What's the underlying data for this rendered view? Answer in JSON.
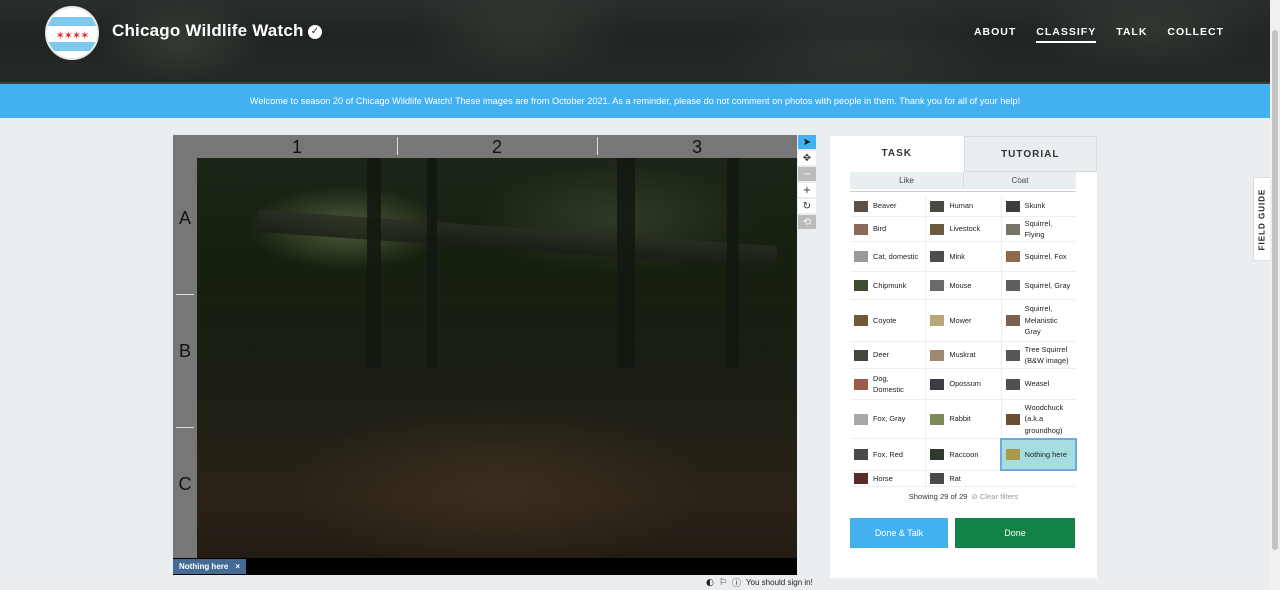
{
  "header": {
    "title": "Chicago Wildlife Watch",
    "verified_mark": "✓",
    "nav": [
      {
        "label": "ABOUT",
        "active": false
      },
      {
        "label": "CLASSIFY",
        "active": true
      },
      {
        "label": "TALK",
        "active": false
      },
      {
        "label": "COLLECT",
        "active": false
      }
    ]
  },
  "banner": {
    "text": "Welcome to season 20 of Chicago Wildlife Watch! These images are from October 2021. As a reminder, please do not comment on photos with people in them. Thank you for all of your help!"
  },
  "viewer": {
    "columns": [
      "1",
      "2",
      "3"
    ],
    "rows": [
      "A",
      "B",
      "C"
    ],
    "selected_tag": "Nothing here",
    "tag_close": "×",
    "sign_in_note": "You should sign in!"
  },
  "task_panel": {
    "tabs": [
      "TASK",
      "TUTORIAL"
    ],
    "filters": [
      "Like",
      "Coat"
    ],
    "choices": [
      [
        {
          "label": "Beaver",
          "color": "#5b5046"
        },
        {
          "label": "Human",
          "color": "#4a4a44"
        },
        {
          "label": "Skunk",
          "color": "#3d3d3d"
        }
      ],
      [
        {
          "label": "Bird",
          "color": "#8a6a5a"
        },
        {
          "label": "Livestock",
          "color": "#6b5a3e"
        },
        {
          "label": "Squirrel, Flying",
          "color": "#77746c"
        }
      ],
      [
        {
          "label": "Cat, domestic",
          "color": "#9a9a9a"
        },
        {
          "label": "Mink",
          "color": "#4d4d4d"
        },
        {
          "label": "Squirrel, Fox",
          "color": "#8b6a4f"
        }
      ],
      [
        {
          "label": "Chipmunk",
          "color": "#3f4a32"
        },
        {
          "label": "Mouse",
          "color": "#6a6a6a"
        },
        {
          "label": "Squirrel, Gray",
          "color": "#5e5e5e"
        }
      ],
      [
        {
          "label": "Coyote",
          "color": "#6e5a3a"
        },
        {
          "label": "Mower",
          "color": "#b8a878"
        },
        {
          "label": "Squirrel, Melanistic Gray",
          "color": "#7a6050"
        }
      ],
      [
        {
          "label": "Deer",
          "color": "#45453f"
        },
        {
          "label": "Muskrat",
          "color": "#a08870"
        },
        {
          "label": "Tree Squirrel (B&W image)",
          "color": "#555"
        }
      ],
      [
        {
          "label": "Dog, Domestic",
          "color": "#9b5c4e"
        },
        {
          "label": "Opossum",
          "color": "#3c3c44"
        },
        {
          "label": "Weasel",
          "color": "#4f4f4f"
        }
      ],
      [
        {
          "label": "Fox, Gray",
          "color": "#a8a8a8"
        },
        {
          "label": "Rabbit",
          "color": "#7d8a5a"
        },
        {
          "label": "Woodchuck (a.k.a groundhog)",
          "color": "#6b4e32"
        }
      ],
      [
        {
          "label": "Fox, Red",
          "color": "#4a4a4a"
        },
        {
          "label": "Raccoon",
          "color": "#2f3a2a"
        },
        {
          "label": "Nothing here",
          "color": "#a89a48",
          "selected": true
        }
      ],
      [
        {
          "label": "Horse",
          "color": "#5a2a2a"
        },
        {
          "label": "Rat",
          "color": "#4a4a4a"
        }
      ]
    ],
    "showing": "Showing 29 of 29",
    "clear_filters": "Clear filters",
    "done_talk": "Done & Talk",
    "done": "Done"
  },
  "field_guide": "FIELD GUIDE"
}
